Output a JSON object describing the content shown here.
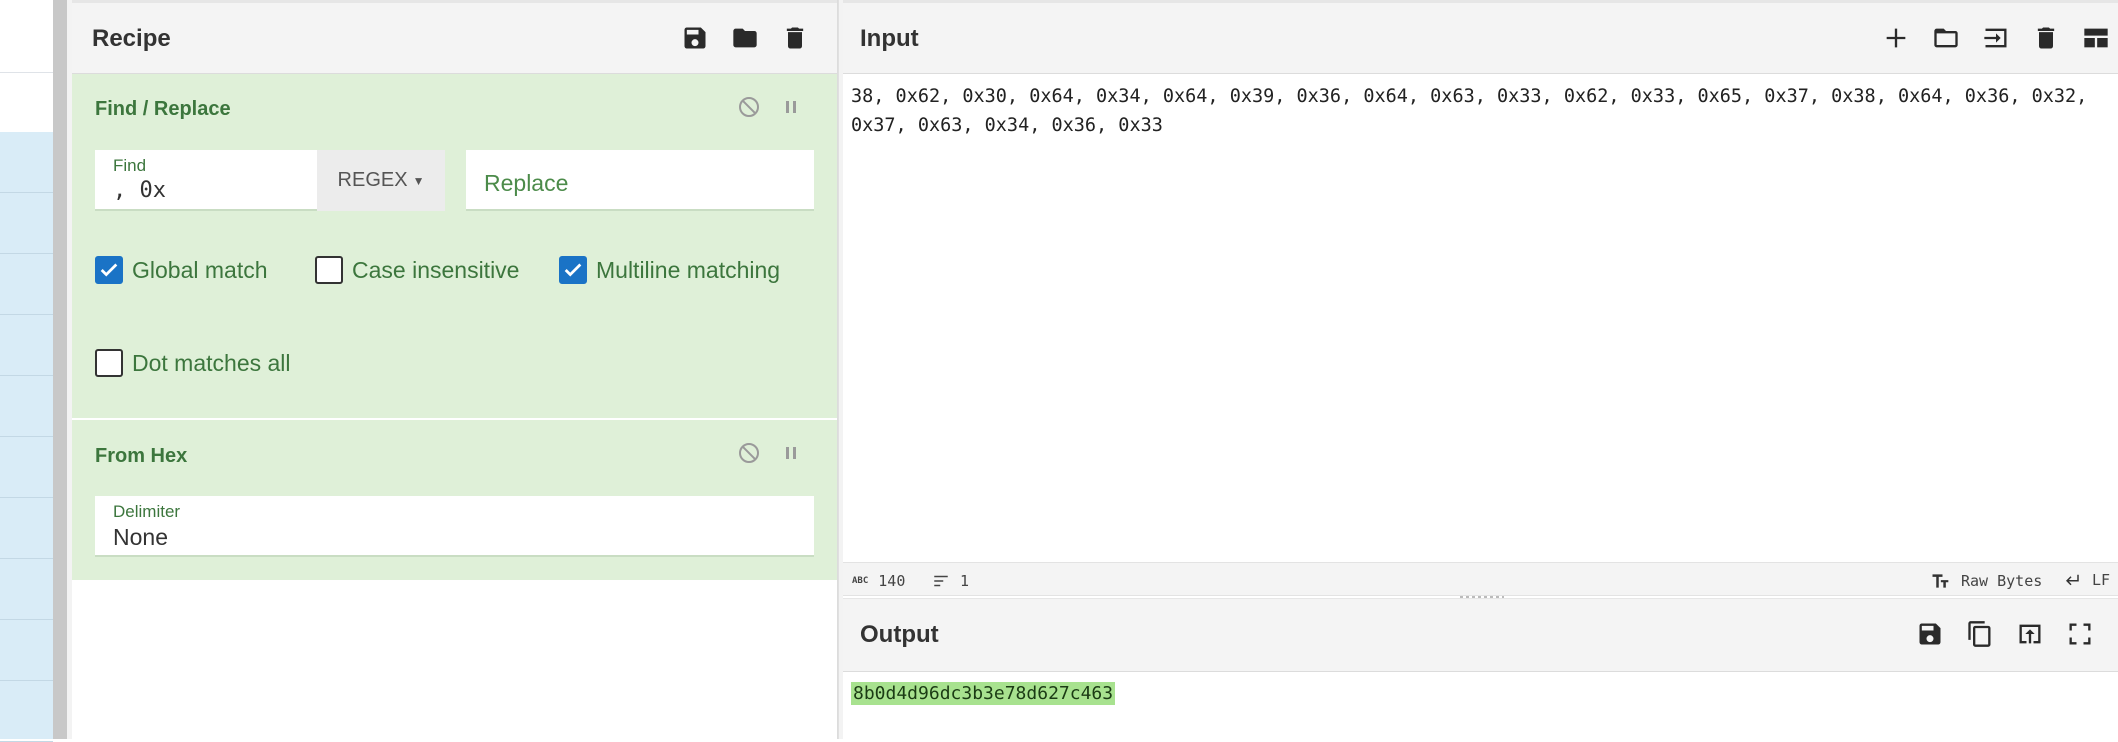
{
  "recipe": {
    "title": "Recipe",
    "header_icons": [
      "save-icon",
      "folder-icon",
      "trash-icon"
    ],
    "operations": [
      {
        "name": "Find / Replace",
        "find_label": "Find",
        "find_value": ", 0x",
        "find_mode": "REGEX",
        "replace_placeholder": "Replace",
        "checkboxes": [
          {
            "label": "Global match",
            "checked": true
          },
          {
            "label": "Case insensitive",
            "checked": false
          },
          {
            "label": "Multiline matching",
            "checked": true
          },
          {
            "label": "Dot matches all",
            "checked": false
          }
        ]
      },
      {
        "name": "From Hex",
        "delimiter_label": "Delimiter",
        "delimiter_value": "None"
      }
    ]
  },
  "input": {
    "title": "Input",
    "header_icons": [
      "plus-icon",
      "folder-icon",
      "import-icon",
      "trash-icon",
      "layout-icon"
    ],
    "text": "38, 0x62, 0x30, 0x64, 0x34, 0x64, 0x39, 0x36, 0x64, 0x63, 0x33, 0x62, 0x33, 0x65, 0x37, 0x38, 0x64, 0x36, 0x32, 0x37, 0x63, 0x34, 0x36, 0x33",
    "status": {
      "abc_badge": "ABC",
      "char_count": "140",
      "line_count": "1",
      "encoding": "Raw Bytes",
      "eol": "LF"
    }
  },
  "output": {
    "title": "Output",
    "header_icons": [
      "save-icon",
      "copy-icon",
      "replace-input-icon",
      "fullscreen-icon"
    ],
    "text": "8b0d4d96dc3b3e78d627c463",
    "highlight_color": "#a8e28f"
  },
  "colors": {
    "accent_green_bg": "#dff0d8",
    "accent_green_text": "#3c763d",
    "checkbox_blue": "#1a73c6"
  }
}
